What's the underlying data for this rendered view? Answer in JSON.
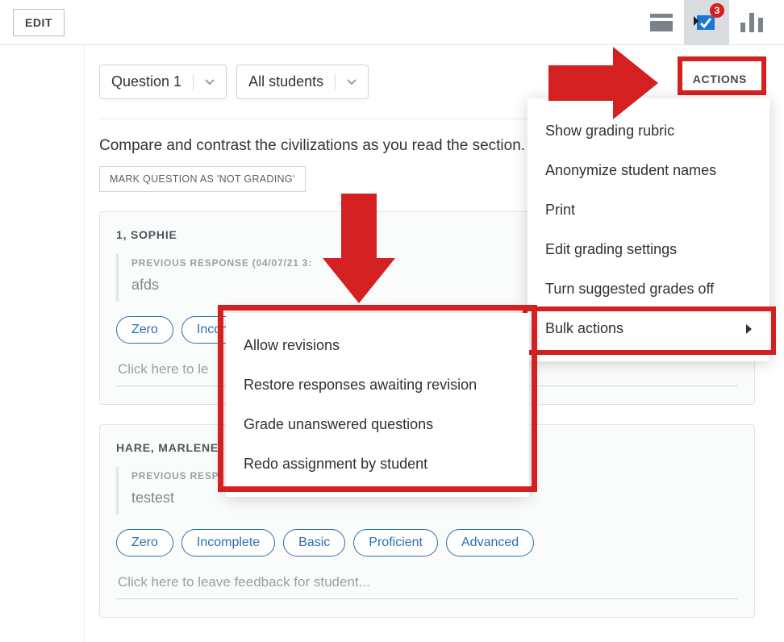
{
  "topbar": {
    "edit_label": "EDIT",
    "badge_count": "3"
  },
  "filters": {
    "question": "Question 1",
    "audience": "All students"
  },
  "prompt_text": "Compare and contrast the civilizations as you read the section.",
  "mark_not_grading_label": "MARK QUESTION AS 'NOT GRADING'",
  "grade_chips": [
    "Zero",
    "Incomplete",
    "Basic",
    "Proficient",
    "Advanced"
  ],
  "feedback_placeholder": "Click here to leave feedback for student...",
  "students": [
    {
      "name": "1, SOPHIE",
      "prev_label": "PREVIOUS RESPONSE (04/07/21 3:",
      "prev_body": "afds"
    },
    {
      "name": "HARE, MARLENE",
      "prev_label": "PREVIOUS RESP",
      "prev_body": "testest"
    }
  ],
  "actions_button": "ACTIONS",
  "actions_menu": [
    "Show grading rubric",
    "Anonymize student names",
    "Print",
    "Edit grading settings",
    "Turn suggested grades off",
    "Bulk actions"
  ],
  "bulk_submenu": [
    "Allow revisions",
    "Restore responses awaiting revision",
    "Grade unanswered questions",
    "Redo assignment by student"
  ],
  "colors": {
    "highlight": "#d42020",
    "primary": "#1976d2"
  }
}
